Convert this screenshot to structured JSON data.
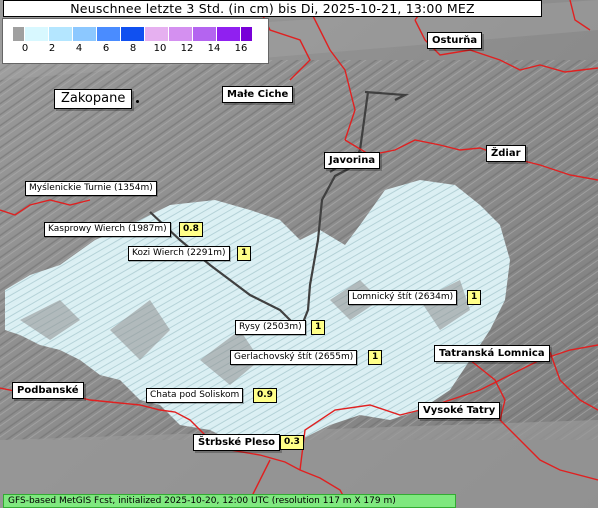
{
  "title": "Neuschnee letzte 3 Std. (in cm) bis Di, 2025-10-21, 13:00 MEZ",
  "legend": {
    "ticks": [
      "0",
      "2",
      "4",
      "6",
      "8",
      "10",
      "12",
      "14",
      "16"
    ],
    "colors": [
      "#a0a0a0",
      "#d8f8ff",
      "#b4e6ff",
      "#8cc8ff",
      "#4a8cff",
      "#1050f0",
      "#e6b0f0",
      "#d490f0",
      "#b464f0",
      "#9020f0",
      "#7800d8"
    ]
  },
  "places": {
    "zakopane": "Zakopane",
    "male_ciche": "Małe Ciche",
    "osturna": "Osturňa",
    "zdiar": "Ždiar",
    "javorina": "Javorina",
    "podbanske": "Podbanské",
    "tatranska_lomnica": "Tatranská Lomnica",
    "vysoke_tatry": "Vysoké Tatry",
    "strbske_pleso": "Štrbské Pleso"
  },
  "peaks": {
    "mysl": "Myślenickie Turnie (1354m)",
    "kasprowy": "Kasprowy Wierch (1987m)",
    "kozi": "Kozi Wierch (2291m)",
    "lomnicky": "Lomnický štít (2634m)",
    "rysy": "Rysy (2503m)",
    "gerlach": "Gerlachovský štít (2655m)",
    "solisko": "Chata pod Soliskom"
  },
  "values": {
    "kasprowy": "0.8",
    "kozi": "1",
    "lomnicky": "1",
    "rysy": "1",
    "gerlach": "1",
    "solisko": "0.9",
    "strbske_pleso": "0.3"
  },
  "footer": "GFS-based MetGIS Fcst, initialized 2025-10-20, 12:00 UTC  (resolution 117 m X 179 m)",
  "colors": {
    "border_country": "#e02020",
    "border_region": "#404040",
    "snow": "#d4f4fa"
  }
}
